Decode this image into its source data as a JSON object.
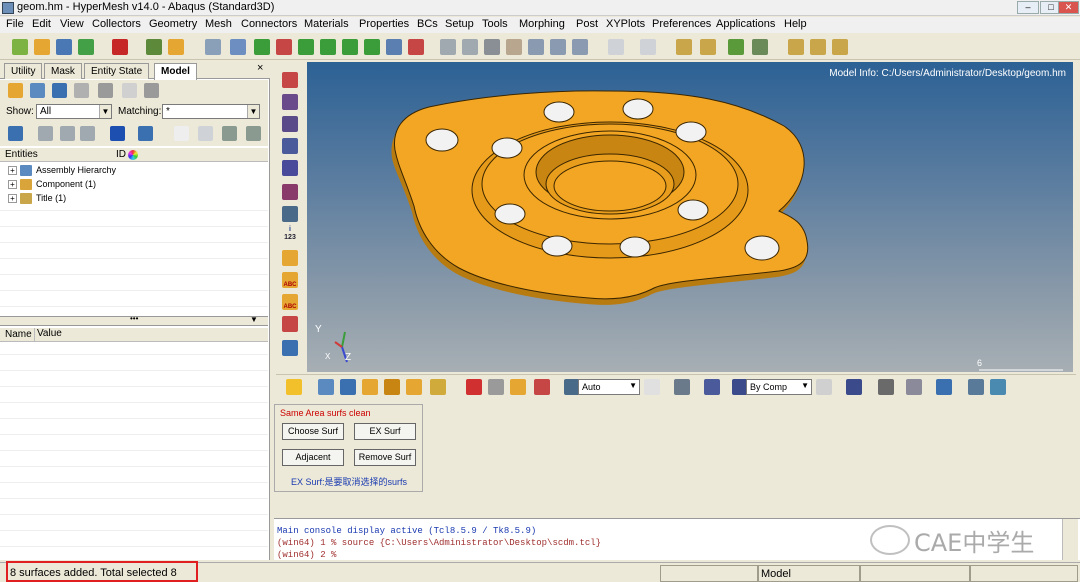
{
  "window": {
    "title": "geom.hm - HyperMesh v14.0 - Abaqus (Standard3D)"
  },
  "menu": [
    "File",
    "Edit",
    "View",
    "Collectors",
    "Geometry",
    "Mesh",
    "Connectors",
    "Materials",
    "Properties",
    "BCs",
    "Setup",
    "Tools",
    "Morphing",
    "Post",
    "XYPlots",
    "Preferences",
    "Applications",
    "Help"
  ],
  "tabs": [
    "Utility",
    "Mask",
    "Entity State",
    "Model"
  ],
  "filter": {
    "show_label": "Show:",
    "show_value": "All",
    "matching_label": "Matching:",
    "matching_value": "*"
  },
  "entities": {
    "col1": "Entities",
    "col2": "ID",
    "items": [
      {
        "label": "Assembly Hierarchy"
      },
      {
        "label": "Component (1)"
      },
      {
        "label": "Title (1)"
      }
    ]
  },
  "props": {
    "col1": "Name",
    "col2": "Value"
  },
  "viewport": {
    "info": "Model Info: C:/Users/Administrator/Desktop/geom.hm",
    "scale_label": "6",
    "axis_y": "Y",
    "axis_z": "Z",
    "axis_x": "X"
  },
  "bottom_toolbar": {
    "auto_label": "Auto",
    "bycomp_label": "By Comp"
  },
  "vtool_labels": {
    "num": "123",
    "abc1": "ABC",
    "abc2": "ABC"
  },
  "panel": {
    "title": "Same Area surfs clean",
    "buttons": [
      "Choose Surf",
      "EX Surf",
      "Adjacent",
      "Remove Surf"
    ],
    "note": "EX Surf:是要取消选择的surfs"
  },
  "console": {
    "lines": [
      "Main console display active (Tcl8.5.9 / Tk8.5.9)",
      "(win64) 1 % source {C:\\Users\\Administrator\\Desktop\\scdm.tcl}",
      "(win64) 2 %"
    ]
  },
  "watermark": "CAE中学生",
  "status": {
    "message": "8 surfaces added. Total selected 8",
    "model": "Model"
  },
  "colors": {
    "part": "#f2a623",
    "hole": "#f2f2f2",
    "edge": "#2a1a00",
    "highlight": "#e02020"
  }
}
